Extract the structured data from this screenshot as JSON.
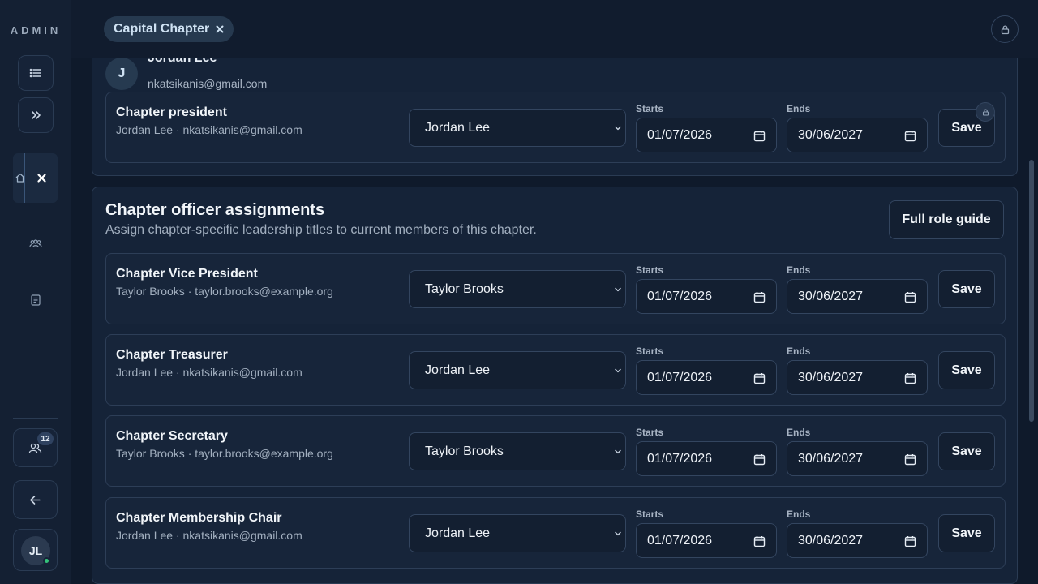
{
  "sidebar": {
    "brand": "ADMIN",
    "icons": {
      "list": "list-icon",
      "expand": "chevrons-right-icon",
      "home": "home-icon",
      "close": "close-icon",
      "people": "people-icon",
      "document": "document-icon",
      "users": "users-icon",
      "back": "arrow-left-icon"
    },
    "requests_badge": "12",
    "user_initials": "JL"
  },
  "header": {
    "chip_label": "Capital Chapter",
    "lock_icon": "lock-icon"
  },
  "president_card": {
    "member_initial": "J",
    "member_name": "Jordan Lee",
    "member_email": "nkatsikanis@gmail.com",
    "row": {
      "title": "Chapter president",
      "subtitle": "Jordan Lee · nkatsikanis@gmail.com",
      "selected": "Jordan Lee",
      "starts_label": "Starts",
      "starts": "01/07/2026",
      "ends_label": "Ends",
      "ends": "30/06/2027",
      "save_label": "Save"
    }
  },
  "officers": {
    "title": "Chapter officer assignments",
    "description": "Assign chapter-specific leadership titles to current members of this chapter.",
    "guide_label": "Full role guide",
    "rows": [
      {
        "title": "Chapter Vice President",
        "subtitle": "Taylor Brooks · taylor.brooks@example.org",
        "selected": "Taylor Brooks",
        "starts_label": "Starts",
        "starts": "01/07/2026",
        "ends_label": "Ends",
        "ends": "30/06/2027",
        "save_label": "Save"
      },
      {
        "title": "Chapter Treasurer",
        "subtitle": "Jordan Lee · nkatsikanis@gmail.com",
        "selected": "Jordan Lee",
        "starts_label": "Starts",
        "starts": "01/07/2026",
        "ends_label": "Ends",
        "ends": "30/06/2027",
        "save_label": "Save"
      },
      {
        "title": "Chapter Secretary",
        "subtitle": "Taylor Brooks · taylor.brooks@example.org",
        "selected": "Taylor Brooks",
        "starts_label": "Starts",
        "starts": "01/07/2026",
        "ends_label": "Ends",
        "ends": "30/06/2027",
        "save_label": "Save"
      },
      {
        "title": "Chapter Membership Chair",
        "subtitle": "Jordan Lee · nkatsikanis@gmail.com",
        "selected": "Jordan Lee",
        "starts_label": "Starts",
        "starts": "01/07/2026",
        "ends_label": "Ends",
        "ends": "30/06/2027",
        "save_label": "Save"
      }
    ]
  }
}
